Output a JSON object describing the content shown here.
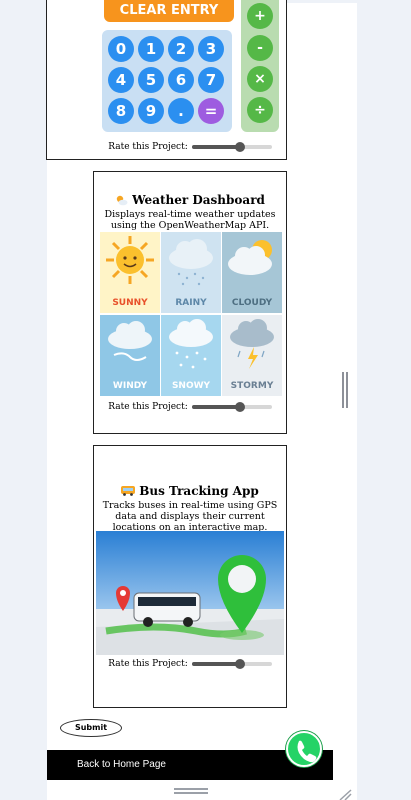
{
  "calculator": {
    "clear_label": "CLEAR ENTRY",
    "keys": [
      "0",
      "1",
      "2",
      "3",
      "4",
      "5",
      "6",
      "7",
      "8",
      "9",
      ".",
      "="
    ],
    "ops": [
      "+",
      "-",
      "×",
      "÷"
    ]
  },
  "cards": [
    {
      "rate_label": "Rate this Project:",
      "rating": 0.6
    },
    {
      "title": "Weather Dashboard",
      "icon": "weather-emoji-icon",
      "description": "Displays real-time weather updates using the OpenWeatherMap API.",
      "rate_label": "Rate this Project:",
      "rating": 0.6
    },
    {
      "title": "Bus Tracking App",
      "icon": "bus-emoji-icon",
      "description": "Tracks buses in real-time using GPS data and displays their current locations on an interactive map.",
      "rate_label": "Rate this Project:",
      "rating": 0.6
    }
  ],
  "weather": [
    {
      "label": "SUNNY",
      "bg": "#fff4c7",
      "color": "#e8502a"
    },
    {
      "label": "RAINY",
      "bg": "#cfe3f1",
      "color": "#5d87a8"
    },
    {
      "label": "CLOUDY",
      "bg": "#a6c6d6",
      "color": "#4e6f82"
    },
    {
      "label": "WINDY",
      "bg": "#8fc7e6",
      "color": "#ffffff"
    },
    {
      "label": "SNOWY",
      "bg": "#a6d7ef",
      "color": "#ffffff"
    },
    {
      "label": "STORMY",
      "bg": "#eaeef2",
      "color": "#6a7f93"
    }
  ],
  "submit_label": "Submit",
  "footer_link": "Back to Home Page",
  "colors": {
    "accent_green": "#25d366",
    "footer_bg": "#000000"
  }
}
